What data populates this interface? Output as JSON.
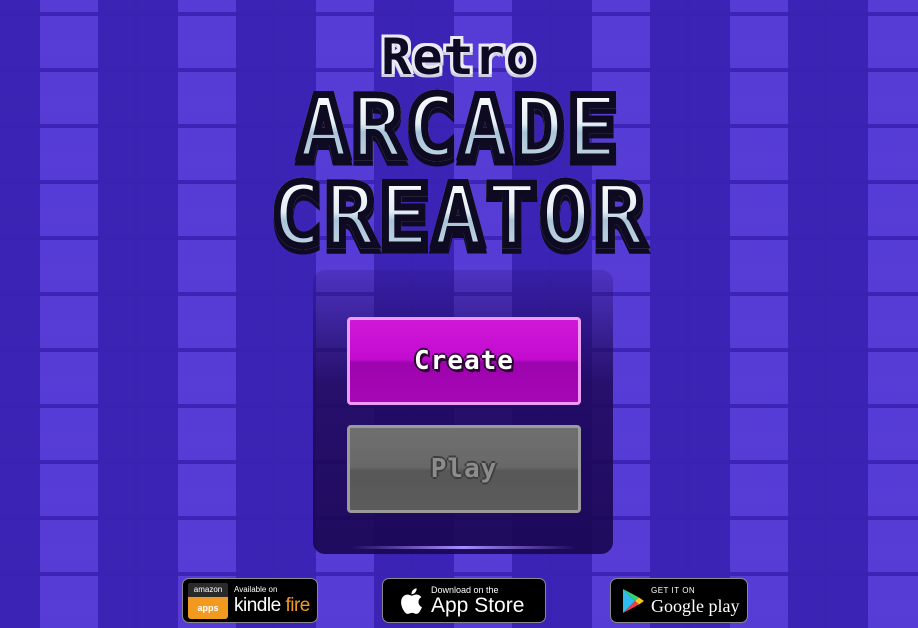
{
  "title": {
    "line1": "Retro",
    "line2": "ARCADE",
    "line3": "CREATOR"
  },
  "menu": {
    "create_label": "Create",
    "play_label": "Play",
    "play_enabled": false
  },
  "store_badges": {
    "kindle": {
      "small": "Available on",
      "brand1": "kindle",
      "brand2": "fire",
      "icon_top": "amazon",
      "icon_bottom": "apps"
    },
    "apple": {
      "small": "Download on the",
      "brand": "App Store",
      "icon": "apple-icon"
    },
    "google": {
      "small": "GET IT ON",
      "brand": "Google play",
      "icon": "google-play-icon"
    }
  },
  "colors": {
    "background": "#4b30d4",
    "create_button": "#c20bd0",
    "play_button_disabled": "#686868"
  }
}
